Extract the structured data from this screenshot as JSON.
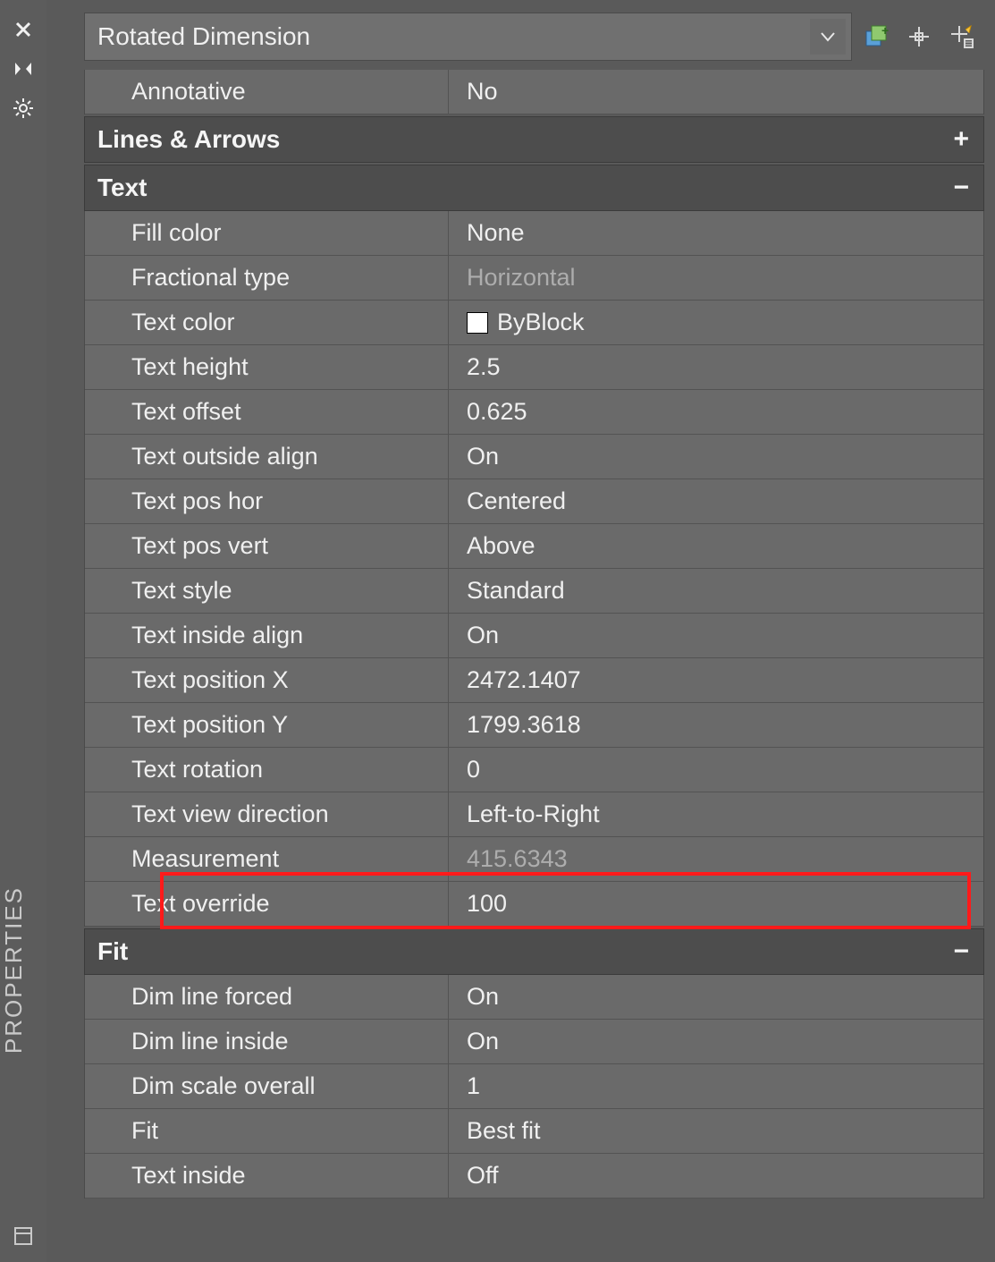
{
  "panel_title": "PROPERTIES",
  "object_type": "Rotated Dimension",
  "top_props": [
    {
      "label": "Annotative",
      "value": "No"
    }
  ],
  "sections": {
    "lines_arrows": {
      "title": "Lines & Arrows",
      "collapsed": true
    },
    "text": {
      "title": "Text",
      "rows": [
        {
          "label": "Fill color",
          "value": "None"
        },
        {
          "label": "Fractional type",
          "value": "Horizontal",
          "muted": true
        },
        {
          "label": "Text color",
          "value": "ByBlock",
          "swatch": true
        },
        {
          "label": "Text height",
          "value": "2.5"
        },
        {
          "label": "Text offset",
          "value": "0.625"
        },
        {
          "label": "Text outside align",
          "value": "On"
        },
        {
          "label": "Text pos hor",
          "value": "Centered"
        },
        {
          "label": "Text pos vert",
          "value": "Above"
        },
        {
          "label": "Text style",
          "value": "Standard"
        },
        {
          "label": "Text inside align",
          "value": "On"
        },
        {
          "label": "Text position X",
          "value": "2472.1407"
        },
        {
          "label": "Text position Y",
          "value": "1799.3618"
        },
        {
          "label": "Text rotation",
          "value": "0"
        },
        {
          "label": "Text view direction",
          "value": "Left-to-Right"
        },
        {
          "label": "Measurement",
          "value": "415.6343",
          "muted": true
        },
        {
          "label": "Text override",
          "value": "100",
          "highlight": true
        }
      ]
    },
    "fit": {
      "title": "Fit",
      "rows": [
        {
          "label": "Dim line forced",
          "value": "On"
        },
        {
          "label": "Dim line inside",
          "value": "On"
        },
        {
          "label": "Dim scale overall",
          "value": "1"
        },
        {
          "label": "Fit",
          "value": "Best fit"
        },
        {
          "label": "Text inside",
          "value": "Off"
        }
      ]
    }
  }
}
